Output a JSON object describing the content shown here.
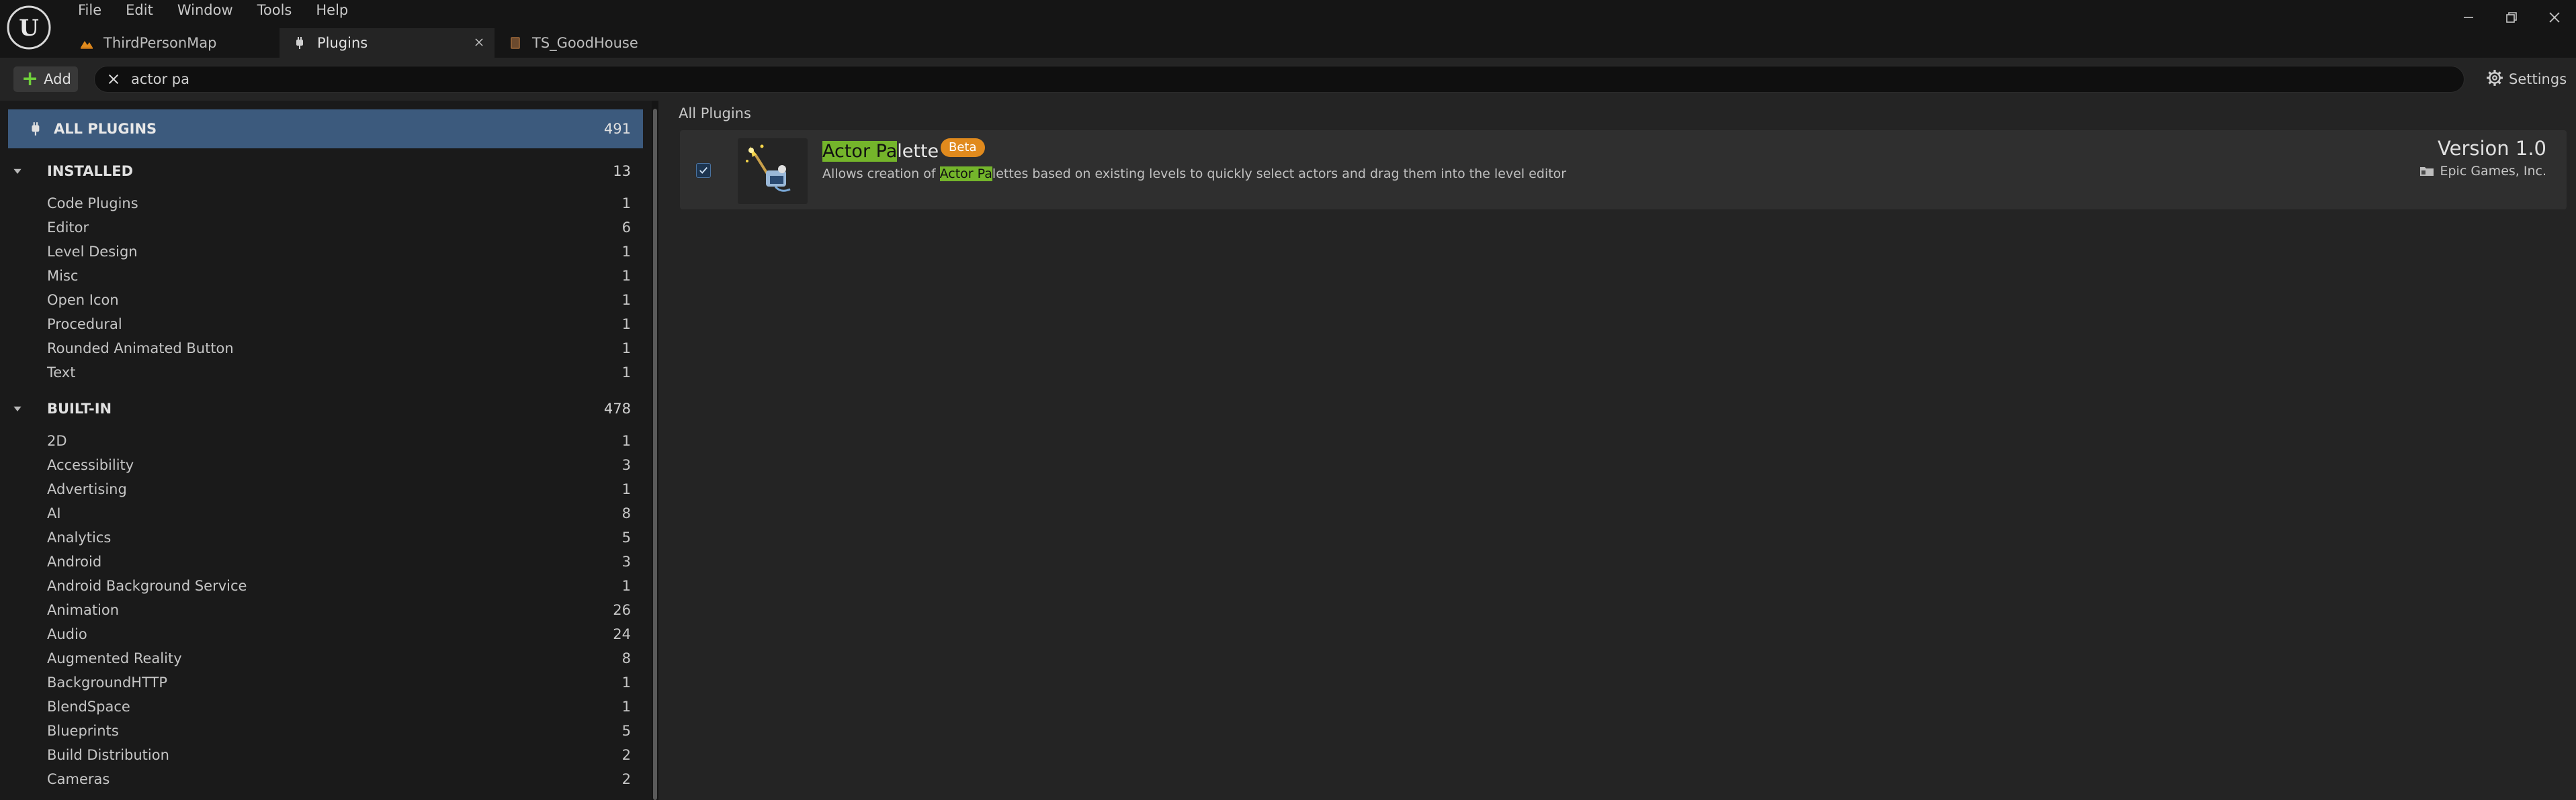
{
  "menu": [
    "File",
    "Edit",
    "Window",
    "Tools",
    "Help"
  ],
  "tabs": [
    {
      "label": "ThirdPersonMap",
      "active": false
    },
    {
      "label": "Plugins",
      "active": true
    },
    {
      "label": "TS_GoodHouse",
      "active": false
    }
  ],
  "toolbar": {
    "add_label": "Add",
    "search_value": "actor pa",
    "settings_label": "Settings"
  },
  "sidebar": {
    "all_plugins": {
      "label": "ALL PLUGINS",
      "count": "491"
    },
    "installed": {
      "label": "INSTALLED",
      "count": "13",
      "items": [
        {
          "label": "Code Plugins",
          "count": "1"
        },
        {
          "label": "Editor",
          "count": "6"
        },
        {
          "label": "Level Design",
          "count": "1"
        },
        {
          "label": "Misc",
          "count": "1"
        },
        {
          "label": "Open Icon",
          "count": "1"
        },
        {
          "label": "Procedural",
          "count": "1"
        },
        {
          "label": "Rounded Animated Button",
          "count": "1"
        },
        {
          "label": "Text",
          "count": "1"
        }
      ]
    },
    "built_in": {
      "label": "BUILT-IN",
      "count": "478",
      "items": [
        {
          "label": "2D",
          "count": "1"
        },
        {
          "label": "Accessibility",
          "count": "3"
        },
        {
          "label": "Advertising",
          "count": "1"
        },
        {
          "label": "AI",
          "count": "8"
        },
        {
          "label": "Analytics",
          "count": "5"
        },
        {
          "label": "Android",
          "count": "3"
        },
        {
          "label": "Android Background Service",
          "count": "1"
        },
        {
          "label": "Animation",
          "count": "26"
        },
        {
          "label": "Audio",
          "count": "24"
        },
        {
          "label": "Augmented Reality",
          "count": "8"
        },
        {
          "label": "BackgroundHTTP",
          "count": "1"
        },
        {
          "label": "BlendSpace",
          "count": "1"
        },
        {
          "label": "Blueprints",
          "count": "5"
        },
        {
          "label": "Build Distribution",
          "count": "2"
        },
        {
          "label": "Cameras",
          "count": "2"
        }
      ]
    }
  },
  "main": {
    "breadcrumb": "All Plugins",
    "plugin": {
      "name_highlight": "Actor Pa",
      "name_rest": "lette",
      "badge": "Beta",
      "desc_prefix": "Allows creation of ",
      "desc_highlight": "Actor Pa",
      "desc_rest": "lettes based on existing levels to quickly select actors and drag them into the level editor",
      "version": "Version 1.0",
      "author": "Epic Games, Inc.",
      "enabled": true
    }
  },
  "colors": {
    "accent_selected": "#3c5a7d",
    "highlight": "#74b52b",
    "beta_badge": "#e08a1d",
    "add_plus": "#6fcf3b"
  },
  "icons": [
    "unreal-logo-icon",
    "minimize-icon",
    "restore-icon",
    "close-icon",
    "map-icon",
    "plug-icon",
    "blueprint-icon",
    "plus-icon",
    "clear-search-icon",
    "gear-icon",
    "chevron-down-icon",
    "checkmark-icon",
    "actor-palette-icon",
    "folder-icon"
  ]
}
